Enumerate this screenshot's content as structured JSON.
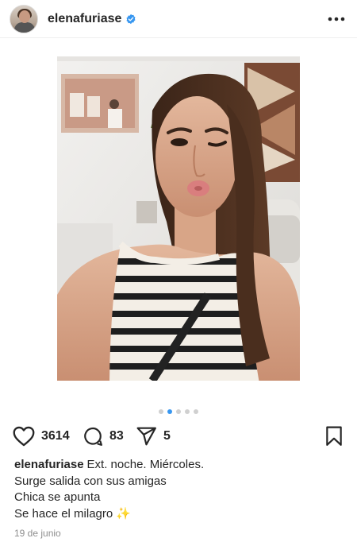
{
  "post": {
    "username": "elenafuriase",
    "verified": true,
    "date": "19 de junio",
    "carousel": {
      "count": 5,
      "active_index": 1
    }
  },
  "actions": {
    "likes": "3614",
    "comments": "83",
    "shares": "5"
  },
  "caption": {
    "username": "elenafuriase",
    "lines": [
      "Ext. noche. Miércoles.",
      "Surge salida con sus amigas",
      "Chica se apunta",
      "Se hace el milagro"
    ],
    "emoji": "✨"
  },
  "icons": {
    "verified": "verified-badge-icon",
    "more": "more-options-icon",
    "like": "heart-icon",
    "comment": "comment-bubble-icon",
    "share": "paper-plane-icon",
    "save": "bookmark-icon"
  },
  "colors": {
    "text": "#262626",
    "verified_blue": "#3897f0",
    "muted": "#8e8e8e",
    "dot_active": "#3897f0",
    "dot_inactive": "#d0d0d0"
  }
}
